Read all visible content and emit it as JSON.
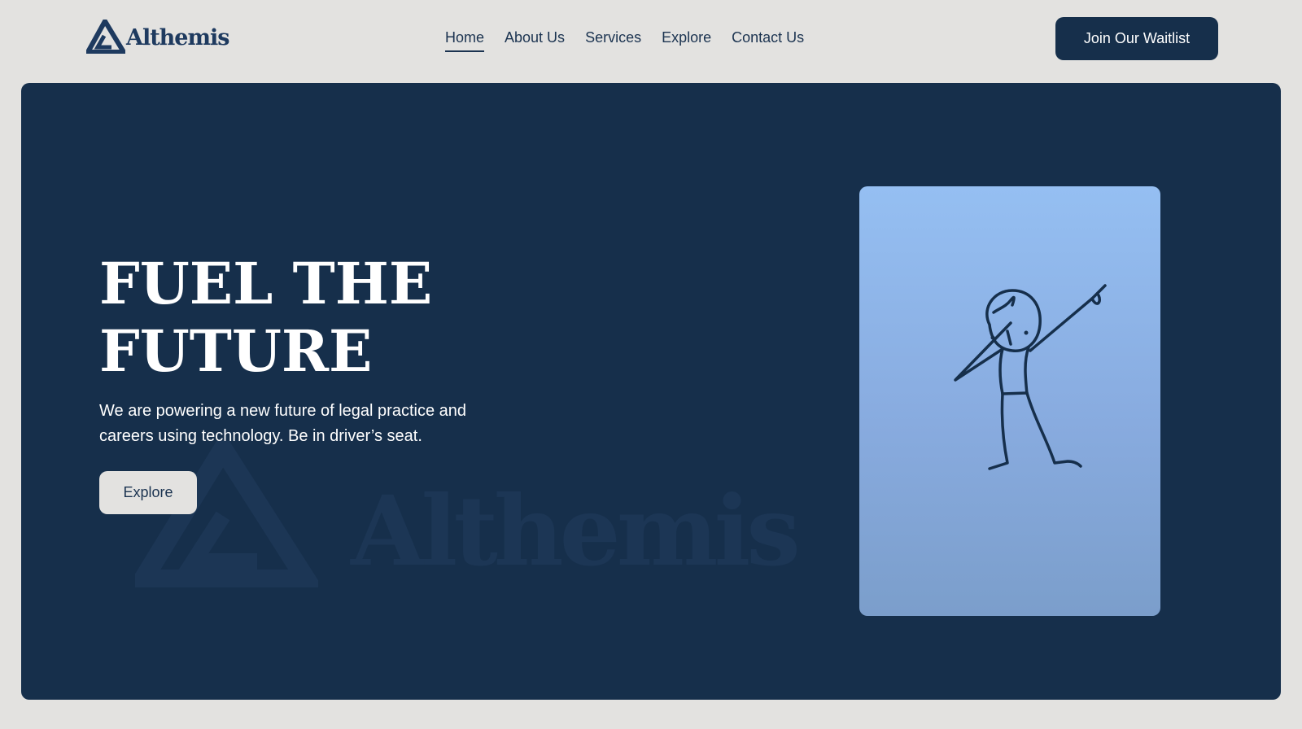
{
  "header": {
    "logo_text": "Althemis",
    "nav": [
      "Home",
      "About Us",
      "Services",
      "Explore",
      "Contact Us"
    ],
    "active_nav": "Home",
    "cta_label": "Join Our Waitlist"
  },
  "hero": {
    "headline_line1": "FUEL THE",
    "headline_line2": "FUTURE",
    "subtext": "We are powering a new future of legal practice and careers using technology. Be in driver’s seat.",
    "button_label": "Explore",
    "watermark_text": "Althemis",
    "illustration": "stick-figure-dab-icon"
  },
  "colors": {
    "navy": "#162f4b",
    "page_bg": "#e3e2e0",
    "text_dark": "#1b3350",
    "illustration_top": "#95bff2",
    "illustration_bottom": "#7b9ecb"
  }
}
